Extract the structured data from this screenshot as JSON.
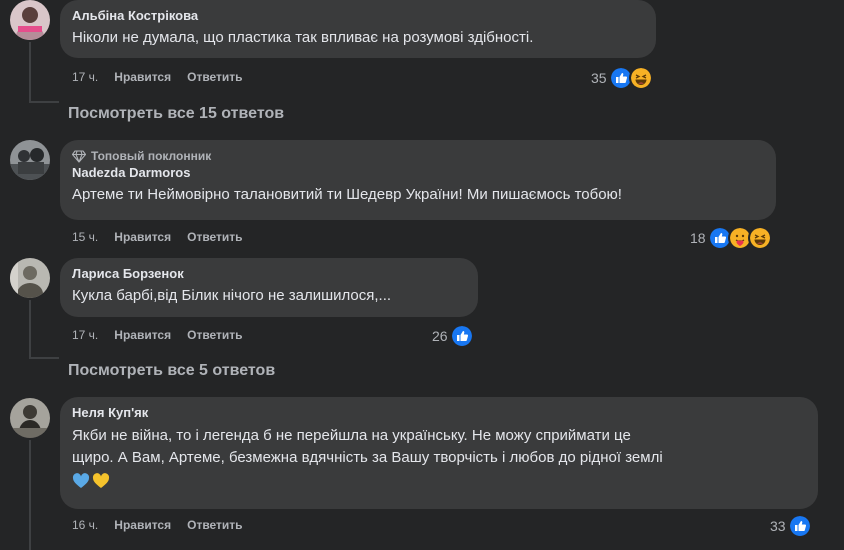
{
  "comments": [
    {
      "author": "Альбіна Кострікова",
      "text": "Ніколи не думала, що пластика так впливає на розумові здібності.",
      "time": "17 ч.",
      "like_label": "Нравится",
      "reply_label": "Ответить",
      "reactions_count": "35",
      "reactions": [
        "like",
        "haha"
      ],
      "view_replies": "Посмотреть все 15 ответов"
    },
    {
      "badge": "Топовый поклонник",
      "author": "Nadezda Darmoros",
      "text": "Артеме ти Неймовірно талановитий ти Шедевр України! Ми пишаємось тобою!",
      "time": "15 ч.",
      "like_label": "Нравится",
      "reply_label": "Ответить",
      "reactions_count": "18",
      "reactions": [
        "like",
        "love-kiss",
        "haha"
      ]
    },
    {
      "author": "Лариса Борзенок",
      "text": "Кукла барбі,від Білик нічого не залишилося,...",
      "time": "17 ч.",
      "like_label": "Нравится",
      "reply_label": "Ответить",
      "reactions_count": "26",
      "reactions": [
        "like"
      ],
      "view_replies": "Посмотреть все 5 ответов"
    },
    {
      "author": "Неля Куп'як",
      "text_line1": "Якби не війна, то і легенда б не перейшла на українську. Не можу сприймати це",
      "text_line2": "щиро. А Вам, Артеме, безмежна вдячність за Вашу творчість і любов до рідної землі",
      "emojis": [
        "blue-heart",
        "yellow-heart"
      ],
      "time": "16 ч.",
      "like_label": "Нравится",
      "reply_label": "Ответить",
      "reactions_count": "33",
      "reactions": [
        "like"
      ]
    }
  ],
  "colors": {
    "background": "#242526",
    "bubble": "#3a3b3c",
    "primary_text": "#e4e6eb",
    "secondary_text": "#b0b3b8",
    "like_blue": "#1877f2"
  }
}
